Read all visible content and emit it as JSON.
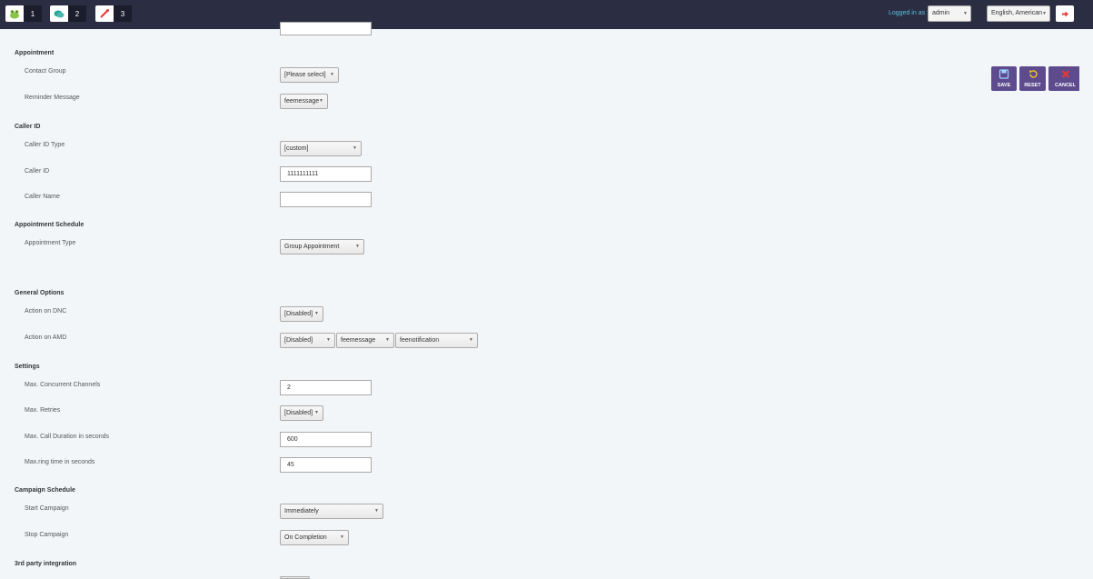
{
  "topbar": {
    "apps": [
      {
        "icon": "frog-icon",
        "num": "1"
      },
      {
        "icon": "chat-icon",
        "num": "2"
      },
      {
        "icon": "wand-icon",
        "num": "3"
      }
    ],
    "logged_in_label": "Logged in as :",
    "user": "admin",
    "language": "English, American"
  },
  "actions": {
    "save": "SAVE",
    "reset": "RESET",
    "cancel": "CANCEL"
  },
  "sections": {
    "appointment": "Appointment",
    "caller_id": "Caller ID",
    "appointment_schedule": "Appointment Schedule",
    "general_options": "General Options",
    "settings": "Settings",
    "campaign_schedule": "Campaign Schedule",
    "third_party": "3rd party integration"
  },
  "fields": {
    "contact_group": {
      "label": "Contact Group",
      "value": "[Please select]"
    },
    "reminder_message": {
      "label": "Reminder Message",
      "value": "feemessage"
    },
    "caller_id_type": {
      "label": "Caller ID Type",
      "value": "[custom]"
    },
    "caller_id": {
      "label": "Caller ID",
      "value": "1111111111"
    },
    "caller_name": {
      "label": "Caller Name",
      "value": ""
    },
    "appointment_type": {
      "label": "Appointment Type",
      "value": "Group Appointment"
    },
    "action_dnc": {
      "label": "Action on DNC",
      "value": "[Disabled]"
    },
    "action_amd": {
      "label": "Action on AMD",
      "value": "[Disabled]",
      "value2": "feemessage",
      "value3": "feenotification"
    },
    "max_channels": {
      "label": "Max. Concurrent Channels",
      "value": "2"
    },
    "max_retries": {
      "label": "Max. Retries",
      "value": "[Disabled]"
    },
    "max_duration": {
      "label": "Max. Call Duration in seconds",
      "value": "600"
    },
    "max_ring": {
      "label": "Max.ring time in seconds",
      "value": "45"
    },
    "start_campaign": {
      "label": "Start Campaign",
      "value": "Immediately"
    },
    "stop_campaign": {
      "label": "Stop Campaign",
      "value": "On Completion"
    }
  },
  "colors": {
    "topbar": "#2b2d42",
    "action_button": "#5d4b8e",
    "accent": "#5bc0de"
  }
}
